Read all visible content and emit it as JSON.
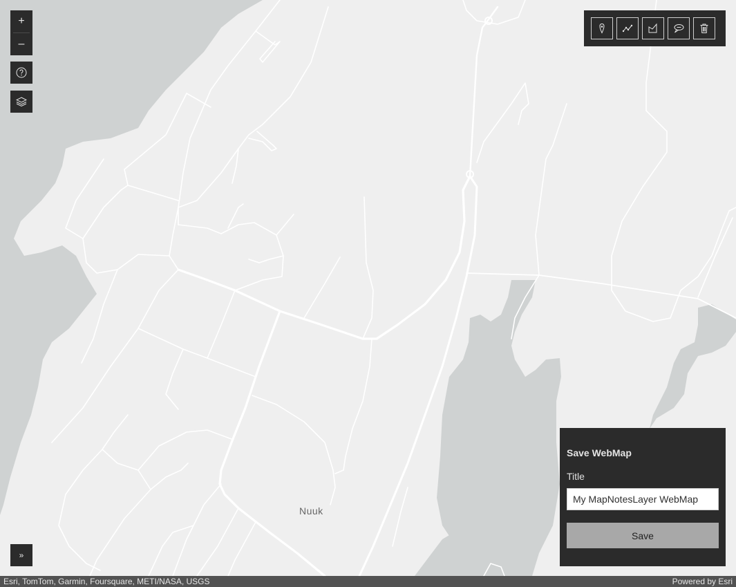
{
  "map": {
    "place_label": "Nuuk",
    "colors": {
      "land": "#efefef",
      "water": "#cfd2d2",
      "road": "#ffffff",
      "panel_bg": "#2b2b2b",
      "button_disabled": "#a8a8a8"
    }
  },
  "zoom": {
    "in_label": "+",
    "out_label": "–",
    "in_icon": "plus-icon",
    "out_icon": "minus-icon"
  },
  "help": {
    "icon": "question-icon"
  },
  "layers": {
    "icon": "layers-icon"
  },
  "sketch_toolbar": {
    "tools": [
      {
        "icon": "point-pin-icon"
      },
      {
        "icon": "polyline-icon"
      },
      {
        "icon": "polygon-icon"
      },
      {
        "icon": "text-annotation-icon"
      },
      {
        "icon": "trash-icon"
      }
    ]
  },
  "save_panel": {
    "heading": "Save WebMap",
    "title_label": "Title",
    "title_value": "My MapNotesLayer WebMap",
    "save_label": "Save"
  },
  "expand": {
    "label": "»",
    "icon": "expand-chevrons-icon"
  },
  "attribution": {
    "sources": "Esri, TomTom, Garmin, Foursquare, METI/NASA, USGS",
    "powered_by": "Powered by Esri"
  }
}
